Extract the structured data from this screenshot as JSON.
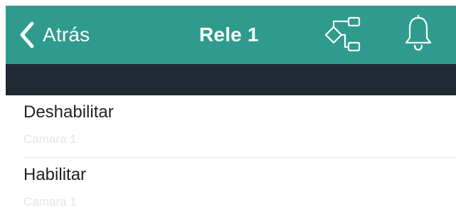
{
  "navbar": {
    "back_label": "Atrás",
    "title": "Rele 1",
    "background_color": "#2f9b8e",
    "icons": [
      "chevron-left-icon",
      "workflow-icon",
      "bell-icon"
    ]
  },
  "subheader": {
    "background_color": "#202a35"
  },
  "list": {
    "items": [
      {
        "title": "Deshabilitar",
        "subtitle": "Camara 1"
      },
      {
        "title": "Habilitar",
        "subtitle": "Camara 1"
      }
    ]
  }
}
